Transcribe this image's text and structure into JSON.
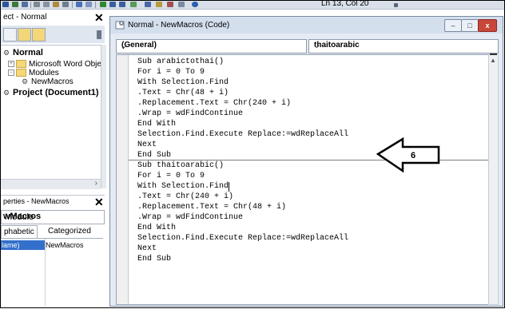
{
  "toolbar": {
    "status": "Ln 13, Col 20"
  },
  "project_panel": {
    "title": "ect - Normal",
    "tree": [
      {
        "label": "Normal",
        "bold": true
      },
      {
        "label": "Microsoft Word Objec"
      },
      {
        "label": "Modules"
      },
      {
        "label": "NewMacros"
      },
      {
        "label": "Project (Document1)",
        "bold": true
      }
    ]
  },
  "properties_panel": {
    "title": "perties - NewMacros",
    "object_bold": "wMacros",
    "object_rest": " Module",
    "tabs": [
      "phabetic",
      "Categorized"
    ],
    "row": {
      "name": "lame)",
      "value": "NewMacros"
    }
  },
  "code_window": {
    "title": "Normal - NewMacros (Code)",
    "object_combo": "(General)",
    "proc_combo": "thaitoarabic",
    "buttons": {
      "minimize": "–",
      "restore": "□",
      "close": "x"
    },
    "lines": [
      "Sub arabictothai()",
      "For i = 0 To 9",
      "With Selection.Find",
      ".Text = Chr(48 + i)",
      ".Replacement.Text = Chr(240 + i)",
      ".Wrap = wdFindContinue",
      "End With",
      "Selection.Find.Execute Replace:=wdReplaceAll",
      "Next",
      "End Sub",
      "Sub thaitoarabic()",
      "For i = 0 To 9",
      "With Selection.Find",
      ".Text = Chr(240 + i)",
      ".Replacement.Text = Chr(48 + i)",
      ".Wrap = wdFindContinue",
      "End With",
      "Selection.Find.Execute Replace:=wdReplaceAll",
      "Next",
      "End Sub"
    ]
  },
  "callout": {
    "label": "6"
  },
  "colors": {
    "selection": "#3370cc",
    "close_button": "#c8463a",
    "title_bar": "#d4dfee"
  }
}
